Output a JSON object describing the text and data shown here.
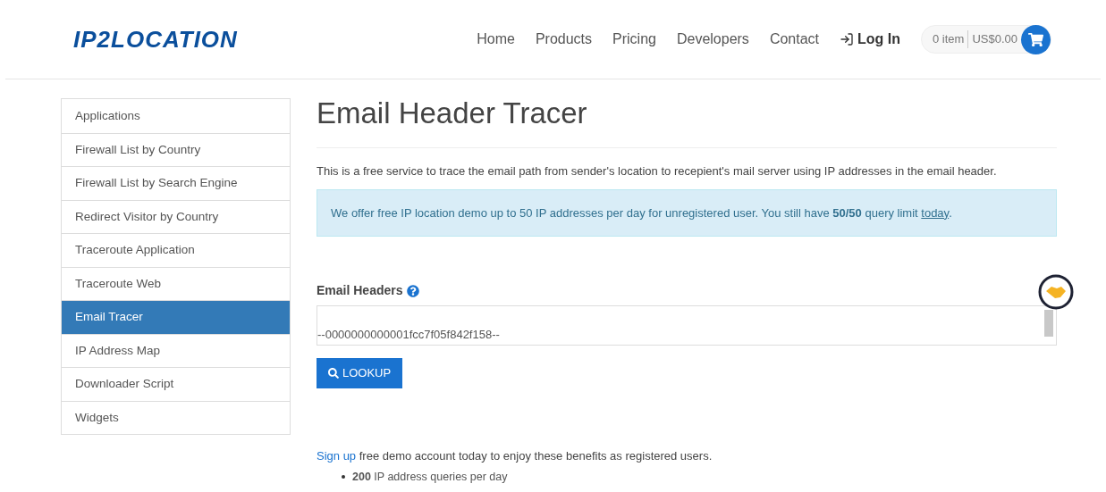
{
  "header": {
    "logo": "IP2LOCATION",
    "nav": [
      {
        "label": "Home"
      },
      {
        "label": "Products"
      },
      {
        "label": "Pricing"
      },
      {
        "label": "Developers"
      },
      {
        "label": "Contact"
      }
    ],
    "login": "Log In",
    "cart": {
      "items": "0 item",
      "total": "US$0.00"
    }
  },
  "sidebar": {
    "items": [
      {
        "label": "Applications",
        "selected": false
      },
      {
        "label": "Firewall List by Country",
        "selected": false
      },
      {
        "label": "Firewall List by Search Engine",
        "selected": false
      },
      {
        "label": "Redirect Visitor by Country",
        "selected": false
      },
      {
        "label": "Traceroute Application",
        "selected": false
      },
      {
        "label": "Traceroute Web",
        "selected": false
      },
      {
        "label": "Email Tracer",
        "selected": true
      },
      {
        "label": "IP Address Map",
        "selected": false
      },
      {
        "label": "Downloader Script",
        "selected": false
      },
      {
        "label": "Widgets",
        "selected": false
      }
    ]
  },
  "main": {
    "title": "Email Header Tracer",
    "intro": "This is a free service to trace the email path from sender's location to recepient's mail server using IP addresses in the email header.",
    "alert": {
      "text": "We offer free IP location demo up to 50 IP addresses per day for unregistered user. You still have **50/50** query limit ",
      "link": "today",
      "end": "."
    },
    "field_label": "Email Headers",
    "field_value": "--0000000000001fcc7f05f842f158--",
    "button": "LOOKUP",
    "signup": {
      "link": "Sign up",
      "text": " free demo account today to enjoy these benefits as registered users."
    },
    "benefits": [
      "**200** IP address queries per day"
    ]
  }
}
